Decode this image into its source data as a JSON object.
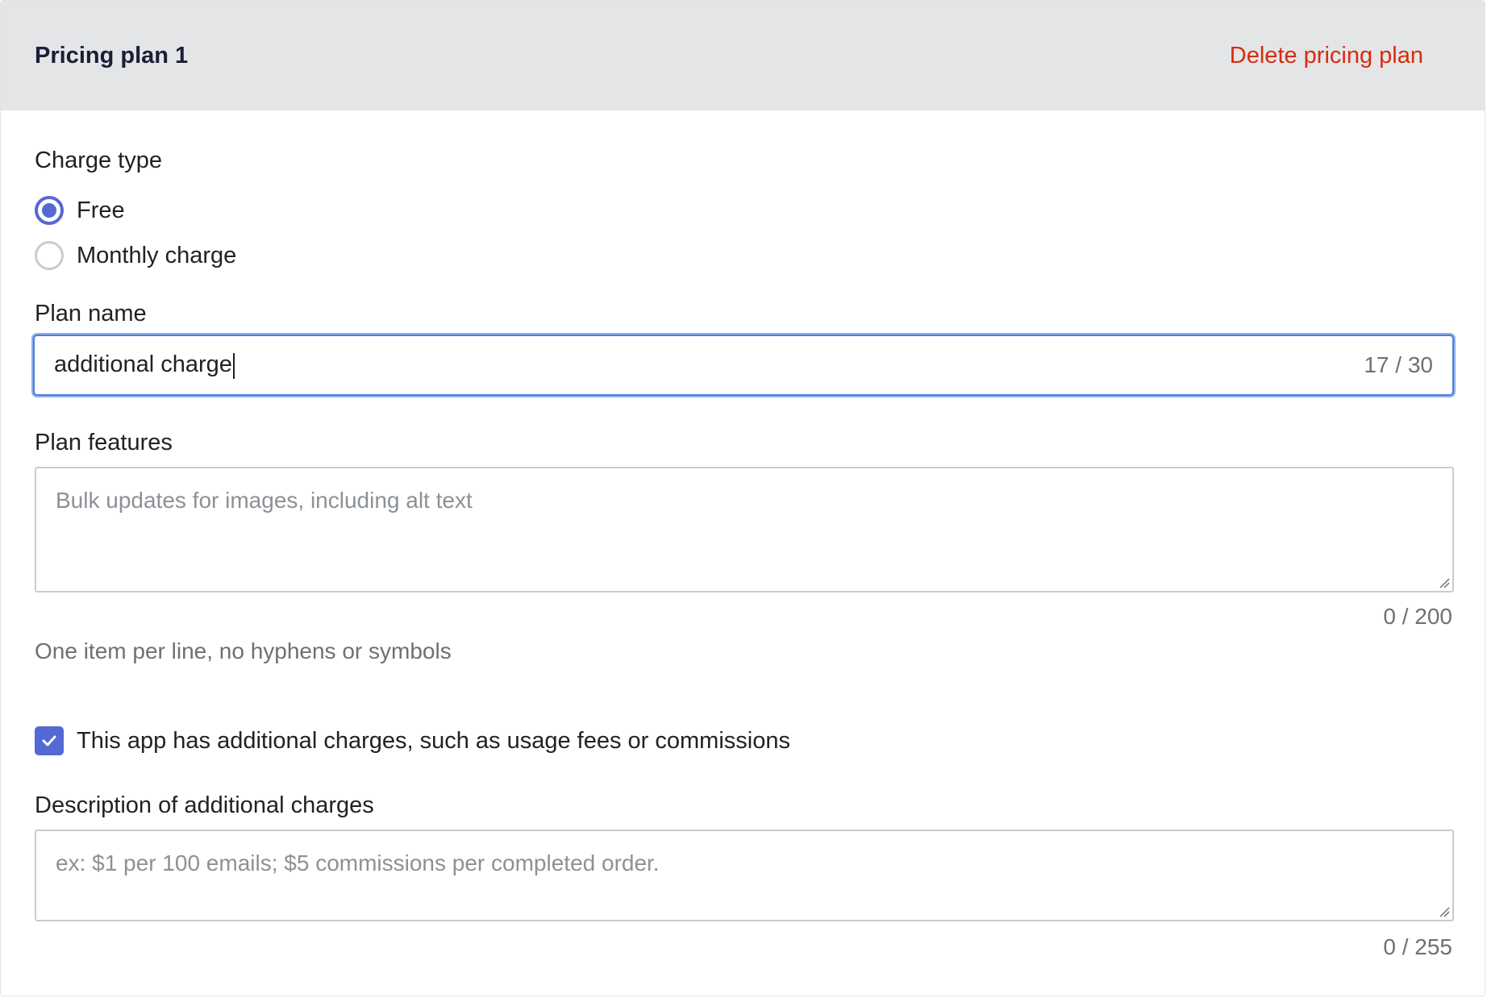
{
  "header": {
    "title": "Pricing plan 1",
    "delete_label": "Delete pricing plan"
  },
  "charge_type": {
    "label": "Charge type",
    "options": [
      {
        "label": "Free",
        "selected": true
      },
      {
        "label": "Monthly charge",
        "selected": false
      }
    ]
  },
  "plan_name": {
    "label": "Plan name",
    "value": "additional charge",
    "counter": "17 / 30"
  },
  "plan_features": {
    "label": "Plan features",
    "placeholder": "Bulk updates for images, including alt text",
    "counter": "0 / 200",
    "help": "One item per line, no hyphens or symbols"
  },
  "additional_charges": {
    "checkbox_label": "This app has additional charges, such as usage fees or commissions",
    "checked": true
  },
  "description": {
    "label": "Description of additional charges",
    "placeholder": "ex: $1 per 100 emails; $5 commissions per completed order.",
    "counter": "0 / 255"
  },
  "colors": {
    "accent": "#5469d4",
    "danger": "#d72c0d",
    "header_bg": "#e4e5e7",
    "focus_ring": "#4f7fd8"
  }
}
